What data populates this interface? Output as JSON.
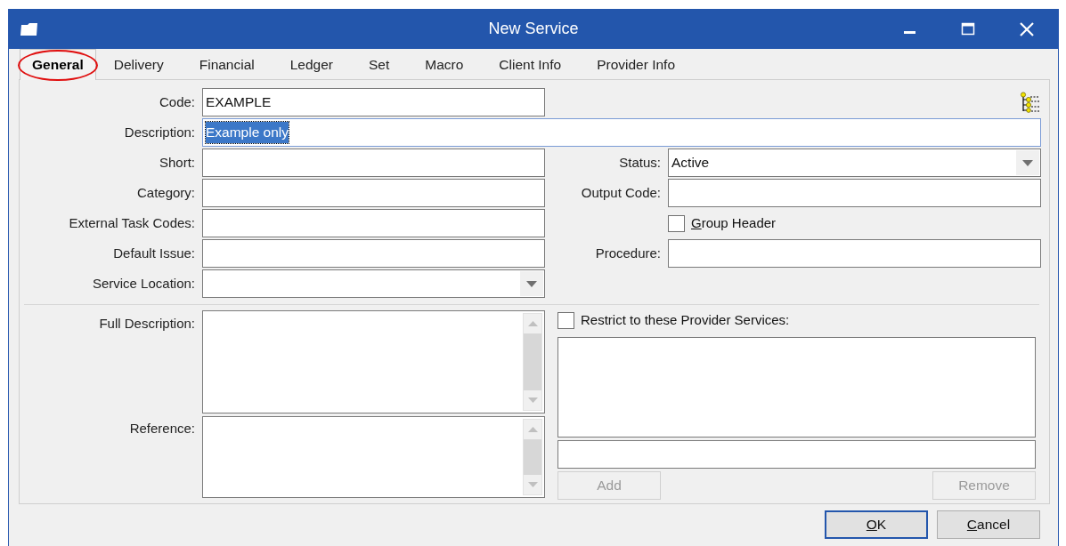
{
  "window": {
    "title": "New Service"
  },
  "tabs": [
    {
      "label": "General",
      "selected": true,
      "circled": true
    },
    {
      "label": "Delivery",
      "selected": false,
      "circled": false
    },
    {
      "label": "Financial",
      "selected": false,
      "circled": false
    },
    {
      "label": "Ledger",
      "selected": false,
      "circled": false
    },
    {
      "label": "Set",
      "selected": false,
      "circled": false
    },
    {
      "label": "Macro",
      "selected": false,
      "circled": false
    },
    {
      "label": "Client Info",
      "selected": false,
      "circled": false
    },
    {
      "label": "Provider Info",
      "selected": false,
      "circled": false
    }
  ],
  "code": {
    "label": "Code:",
    "value": "EXAMPLE"
  },
  "description": {
    "label": "Description:",
    "value": "Example only",
    "text_selected": true
  },
  "left_fields": [
    {
      "label": "Short:",
      "kind": "text"
    },
    {
      "label": "Category:",
      "kind": "text"
    },
    {
      "label": "External Task Codes:",
      "kind": "text"
    },
    {
      "label": "Default Issue:",
      "kind": "text"
    },
    {
      "label": "Service Location:",
      "kind": "dropdown"
    }
  ],
  "right_fields": [
    {
      "label": "Status:",
      "kind": "dropdown",
      "value": "Active"
    },
    {
      "label": "Output Code:",
      "kind": "text"
    },
    {
      "label": "Group Header",
      "kind": "checkbox",
      "checked": false,
      "first_letter_underlined": true
    },
    {
      "label": "Procedure:",
      "kind": "text"
    }
  ],
  "text_areas": [
    {
      "label": "Full Description:"
    },
    {
      "label": "Reference:"
    }
  ],
  "provider_services": {
    "label": "Restrict to these Provider Services:",
    "checked": false,
    "buttons": [
      {
        "label": "Add",
        "disabled": true
      },
      {
        "label": "Remove",
        "disabled": true
      }
    ]
  },
  "buttons": [
    {
      "label": "OK",
      "default": true,
      "first_letter_underlined": true
    },
    {
      "label": "Cancel",
      "default": false,
      "first_letter_underlined": true
    }
  ]
}
